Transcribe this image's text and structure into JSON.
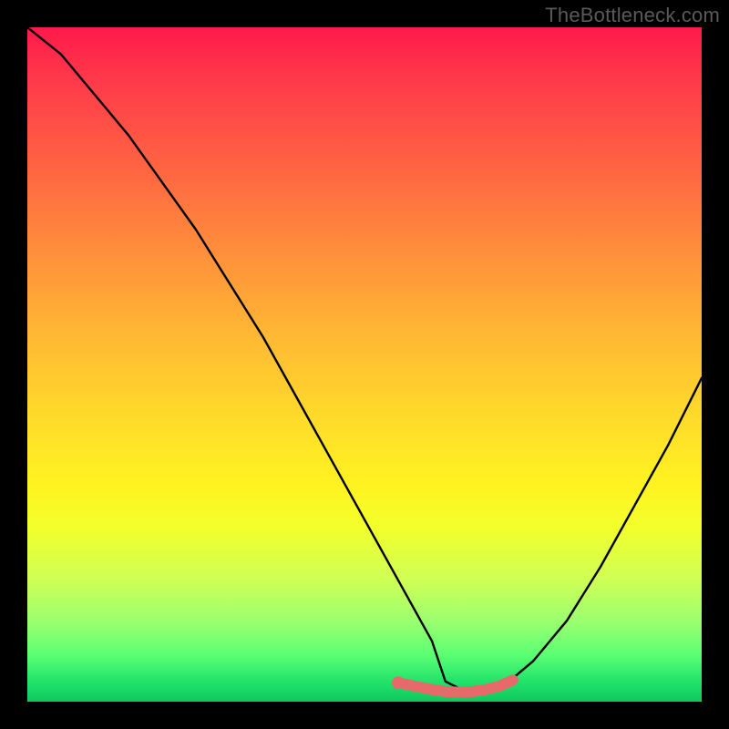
{
  "watermark": "TheBottleneck.com",
  "chart_data": {
    "type": "line",
    "title": "",
    "xlabel": "",
    "ylabel": "",
    "xlim": [
      0,
      100
    ],
    "ylim": [
      0,
      100
    ],
    "series": [
      {
        "name": "bottleneck-curve",
        "color": "#000000",
        "x": [
          0,
          5,
          10,
          15,
          20,
          25,
          30,
          35,
          40,
          45,
          50,
          55,
          60,
          62,
          65,
          68,
          70,
          75,
          80,
          85,
          90,
          95,
          100
        ],
        "values": [
          100,
          96,
          90,
          84,
          77,
          70,
          62,
          54,
          45,
          36,
          27,
          18,
          9,
          3,
          1.5,
          1.5,
          1.8,
          6,
          12,
          20,
          29,
          38,
          48
        ]
      },
      {
        "name": "optimal-range",
        "color": "#e66a6a",
        "x": [
          55,
          58,
          60,
          62,
          64,
          66,
          68,
          70,
          72
        ],
        "values": [
          2.8,
          2.2,
          1.8,
          1.5,
          1.4,
          1.5,
          1.8,
          2.3,
          3.2
        ]
      }
    ],
    "optimal_marker": {
      "x": 55,
      "y": 2.8
    },
    "gradient_stops": [
      {
        "pos": 0,
        "color": "#ff1a4b"
      },
      {
        "pos": 22,
        "color": "#ff6841"
      },
      {
        "pos": 46,
        "color": "#ffb933"
      },
      {
        "pos": 68,
        "color": "#fff321"
      },
      {
        "pos": 88,
        "color": "#9cff6f"
      },
      {
        "pos": 100,
        "color": "#0fc85f"
      }
    ]
  }
}
